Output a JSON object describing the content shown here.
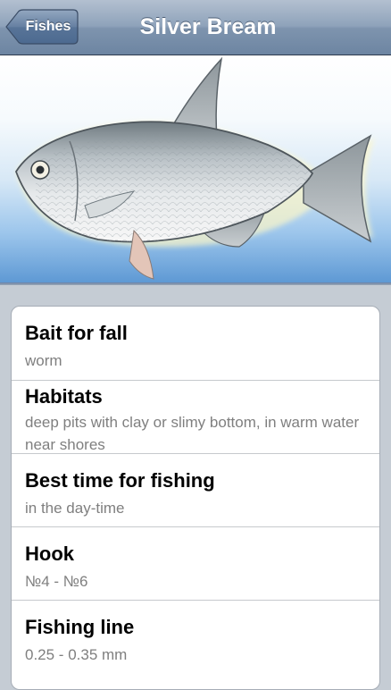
{
  "navbar": {
    "back_label": "Fishes",
    "title": "Silver Bream"
  },
  "hero": {
    "image": "silver-bream-illustration"
  },
  "details": [
    {
      "label": "Bait for fall",
      "value": "worm"
    },
    {
      "label": "Habitats",
      "value": "deep pits with clay or slimy bottom, in warm water near shores"
    },
    {
      "label": "Best time for fishing",
      "value": "in the day-time"
    },
    {
      "label": "Hook",
      "value": "№4 - №6"
    },
    {
      "label": "Fishing line",
      "value": "0.25 - 0.35 mm"
    }
  ],
  "colors": {
    "navbar": "#7e94ae",
    "background": "#c5ccd4",
    "value_text": "#7f7f7f"
  }
}
